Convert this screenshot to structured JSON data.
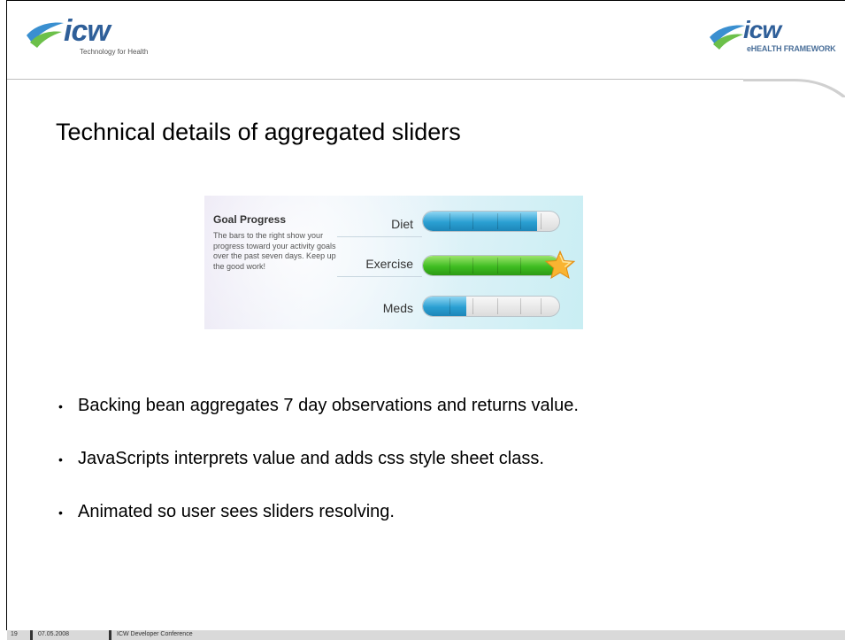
{
  "header": {
    "left_logo": {
      "word": "icw",
      "subtitle": "Technology for Health"
    },
    "right_logo": {
      "word": "icw",
      "subtitle": "eHEALTH FRAMEWORK"
    }
  },
  "slide": {
    "title": "Technical details of aggregated sliders"
  },
  "widget": {
    "title": "Goal Progress",
    "description": "The bars to the right show your progress toward your activity goals over the past seven days. Keep up the good work!",
    "sliders": [
      {
        "label": "Diet",
        "progress": 0.84,
        "color": "#2a9fd2"
      },
      {
        "label": "Exercise",
        "progress": 1.0,
        "color": "#3fbd22",
        "goal_icon": "star-icon"
      },
      {
        "label": "Meds",
        "progress": 0.32,
        "color": "#2a9fd2"
      }
    ]
  },
  "bullets": [
    "Backing bean aggregates 7 day observations and returns value.",
    "JavaScripts interprets value and adds css style sheet class.",
    "Animated so user sees sliders resolving."
  ],
  "footer": {
    "page": "19",
    "date": "07.05.2008",
    "event": "ICW Developer Conference"
  },
  "colors": {
    "brand_blue": "#2f5f99",
    "swoosh_blue": "#3a8fd0",
    "swoosh_green": "#6cc04a"
  }
}
